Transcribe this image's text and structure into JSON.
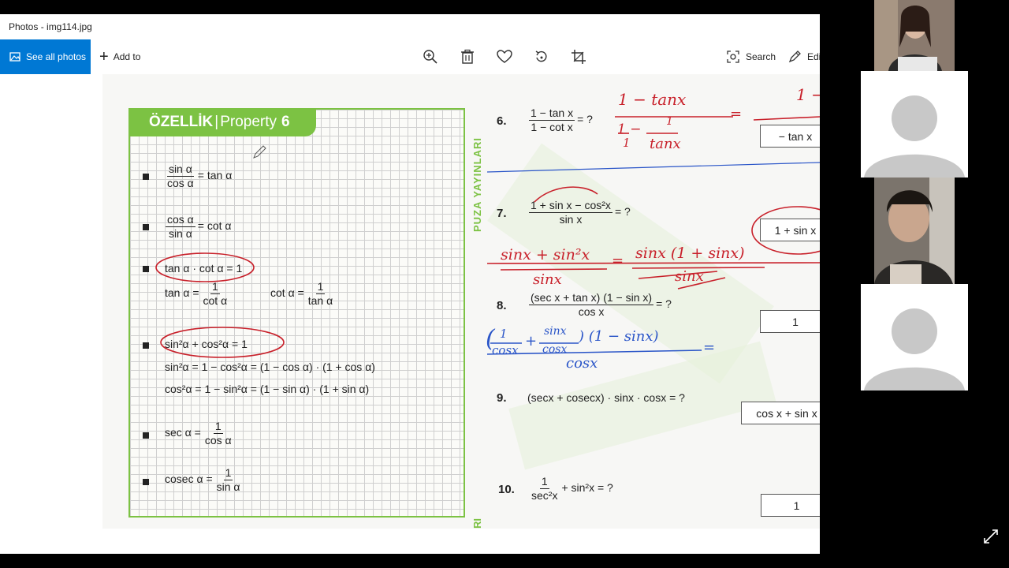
{
  "window": {
    "title": "Photos - img114.jpg"
  },
  "toolbar": {
    "see_all_label": "See all photos",
    "add_to_label": "Add to",
    "search_label": "Search",
    "edit_label": "Edi"
  },
  "property": {
    "header_tr": "ÖZELLİK",
    "header_sep": "|",
    "header_en": "Property",
    "header_num": "6",
    "side_label": "PUZA YAYINLARI",
    "side_label_bottom": "RI",
    "f1": {
      "num": "sin α",
      "den": "cos α",
      "rhs": "= tan α"
    },
    "f2": {
      "num": "cos α",
      "den": "sin α",
      "rhs": "= cot α"
    },
    "f3": "tan α · cot α = 1",
    "f3a": {
      "lhs": "tan α =",
      "num": "1",
      "den": "cot α"
    },
    "f3b": {
      "lhs": "cot α =",
      "num": "1",
      "den": "tan α"
    },
    "f4": "sin²α + cos²α = 1",
    "f4a": "sin²α = 1 − cos²α = (1 − cos α) · (1 + cos α)",
    "f4b": "cos²α = 1 − sin²α = (1 − sin α) · (1 + sin α)",
    "f5": {
      "lhs": "sec α =",
      "num": "1",
      "den": "cos α"
    },
    "f6": {
      "lhs": "cosec α =",
      "num": "1",
      "den": "sin α"
    }
  },
  "questions": [
    {
      "num": "6.",
      "num_top": "1 − tan x",
      "num_bot": "1 − cot x",
      "tail": "= ?",
      "answer": "− tan x"
    },
    {
      "num": "7.",
      "num_top": "1 + sin x − cos²x",
      "num_bot": "sin x",
      "tail": "= ?",
      "answer": "1 + sin x"
    },
    {
      "num": "8.",
      "num_top": "(sec x + tan x) (1 − sin x)",
      "num_bot": "cos x",
      "tail": "= ?",
      "answer": "1"
    },
    {
      "num": "9.",
      "text": "(secx + cosecx) · sinx · cosx = ?",
      "answer": "cos x + sin x"
    },
    {
      "num": "10.",
      "num_top": "1",
      "num_bot": "sec²x",
      "tail": "+ sin²x = ?",
      "answer": "1"
    }
  ],
  "handwriting": {
    "q6_num": "1 − tanx",
    "q6_den_a": "1 −",
    "q6_den_one": "1",
    "q6_den_b": "1",
    "q6_den_c": "tanx",
    "q6_right": "1 −",
    "q6_eq": "=",
    "q7_num_left": "sinx + sin²x",
    "q7_den_left": "sinx",
    "q7_eq": "=",
    "q7_num_right": "sinx (1 + sinx)",
    "q7_den_right": "sinx",
    "q8_open": "(",
    "q8_f1_num": "1",
    "q8_f1_den": "cosx",
    "q8_plus": "+",
    "q8_f2_num": "sinx",
    "q8_f2_den": "cosx",
    "q8_rest": ") (1 − sinx)",
    "q8_den": "cosx",
    "q8_eq": "="
  },
  "colors": {
    "accent": "#0078d4",
    "property_green": "#7cc243",
    "ink_red": "#c8202a",
    "ink_blue": "#2a55c8"
  }
}
